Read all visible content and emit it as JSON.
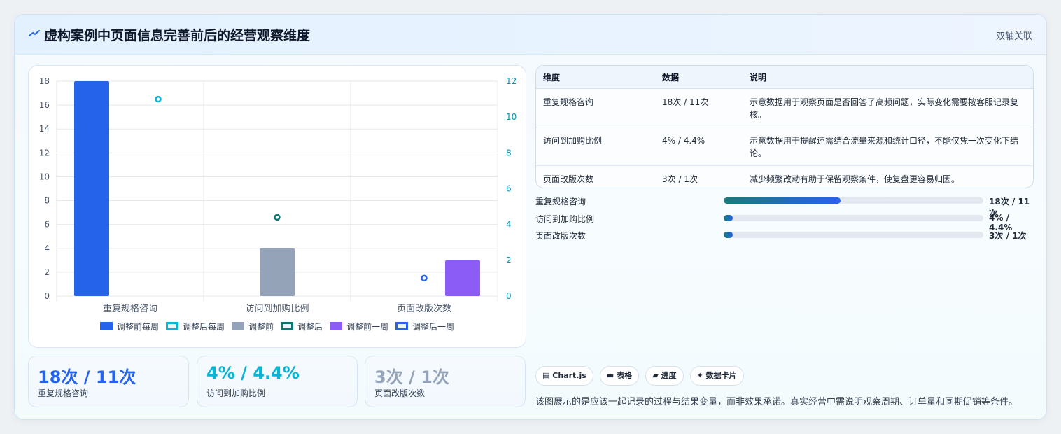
{
  "header": {
    "title": "虚构案例中页面信息完善前后的经营观察维度",
    "tag": "双轴关联"
  },
  "chart_data": {
    "type": "bar",
    "categories": [
      "重复规格咨询",
      "访问到加购比例",
      "页面改版次数"
    ],
    "left_ylim": [
      0,
      18
    ],
    "left_ticks": [
      "0",
      "2",
      "4",
      "6",
      "8",
      "10",
      "12",
      "14",
      "16",
      "18"
    ],
    "right_ylim": [
      0,
      12
    ],
    "right_ticks": [
      "0",
      "2",
      "4",
      "6",
      "8",
      "10",
      "12"
    ],
    "bars": [
      {
        "category": "重复规格咨询",
        "value": 18,
        "color": "#2563eb"
      },
      {
        "category": "访问到加购比例",
        "value": 4,
        "color": "#94a3b8"
      },
      {
        "category": "页面改版次数",
        "value": 3,
        "color": "#8b5cf6"
      }
    ],
    "points": [
      {
        "category": "重复规格咨询",
        "value": 11,
        "color": "#06b6d4"
      },
      {
        "category": "访问到加购比例",
        "value": 4.4,
        "color": "#0f766e"
      },
      {
        "category": "页面改版次数",
        "value": 1,
        "color": "#2563eb"
      }
    ],
    "legend": [
      {
        "label": "调整前每周",
        "color": "#2563eb",
        "style": "solid"
      },
      {
        "label": "调整后每周",
        "color": "#06b6d4",
        "style": "outline"
      },
      {
        "label": "调整前",
        "color": "#94a3b8",
        "style": "solid"
      },
      {
        "label": "调整后",
        "color": "#0f766e",
        "style": "outline"
      },
      {
        "label": "调整前一周",
        "color": "#8b5cf6",
        "style": "solid"
      },
      {
        "label": "调整后一周",
        "color": "#2563eb",
        "style": "outline"
      }
    ],
    "legend_placement": "bottom",
    "grid": true
  },
  "stats": [
    {
      "value": "18次 / 11次",
      "label": "重复规格咨询",
      "color": "#2563eb"
    },
    {
      "value": "4% / 4.4%",
      "label": "访问到加购比例",
      "color": "#06b6d4"
    },
    {
      "value": "3次 / 1次",
      "label": "页面改版次数",
      "color": "#94a3b8"
    }
  ],
  "table": {
    "headers": [
      "维度",
      "数据",
      "说明"
    ],
    "rows": [
      [
        "重复规格咨询",
        "18次 / 11次",
        "示意数据用于观察页面是否回答了高频问题，实际变化需要按客服记录复核。"
      ],
      [
        "访问到加购比例",
        "4% / 4.4%",
        "示意数据用于提醒还需结合流量来源和统计口径，不能仅凭一次变化下结论。"
      ],
      [
        "页面改版次数",
        "3次 / 1次",
        "减少频繁改动有助于保留观察条件，使复盘更容易归因。"
      ]
    ]
  },
  "progress": [
    {
      "label": "重复规格咨询",
      "value": "18次 / 11次",
      "fraction": 0.45
    },
    {
      "label": "访问到加购比例",
      "value": "4% / 4.4%",
      "fraction": 0.035
    },
    {
      "label": "页面改版次数",
      "value": "3次 / 1次",
      "fraction": 0.035
    }
  ],
  "chips": [
    {
      "icon": "chart-icon",
      "glyph": "▤",
      "label": "Chart.js"
    },
    {
      "icon": "table-icon",
      "glyph": "▬",
      "label": "表格"
    },
    {
      "icon": "progress-icon",
      "glyph": "▰",
      "label": "进度"
    },
    {
      "icon": "sparkle-icon",
      "glyph": "✦",
      "label": "数据卡片"
    }
  ],
  "note": "该图展示的是应该一起记录的过程与结果变量，而非效果承诺。真实经营中需说明观察周期、订单量和同期促销等条件。"
}
